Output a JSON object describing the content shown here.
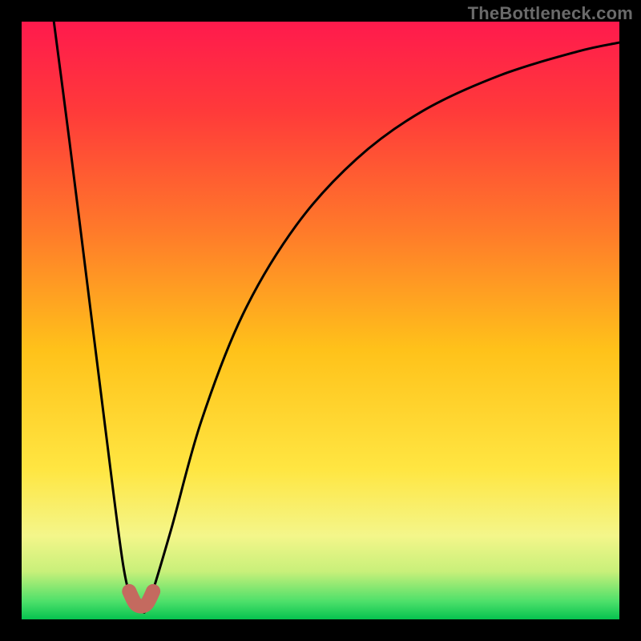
{
  "watermark": "TheBottleneck.com",
  "chart_data": {
    "type": "line",
    "title": "",
    "xlabel": "",
    "ylabel": "",
    "xlim": [
      0,
      1
    ],
    "ylim": [
      0,
      1
    ],
    "gradient_stops": [
      {
        "offset": 0.0,
        "color": "#ff1a4d"
      },
      {
        "offset": 0.15,
        "color": "#ff3a3a"
      },
      {
        "offset": 0.35,
        "color": "#ff7a2a"
      },
      {
        "offset": 0.55,
        "color": "#ffc21a"
      },
      {
        "offset": 0.75,
        "color": "#ffe642"
      },
      {
        "offset": 0.86,
        "color": "#f4f68a"
      },
      {
        "offset": 0.92,
        "color": "#c8f07a"
      },
      {
        "offset": 0.97,
        "color": "#4de06a"
      },
      {
        "offset": 1.0,
        "color": "#06c24f"
      }
    ],
    "series": [
      {
        "name": "bottleneck-curve",
        "color": "#000000",
        "width": 3,
        "x": [
          0.05,
          0.08,
          0.11,
          0.14,
          0.17,
          0.188,
          0.2,
          0.212,
          0.25,
          0.3,
          0.37,
          0.46,
          0.56,
          0.67,
          0.8,
          0.93,
          1.0
        ],
        "values": [
          1.03,
          0.8,
          0.56,
          0.32,
          0.09,
          0.025,
          0.015,
          0.025,
          0.15,
          0.33,
          0.51,
          0.66,
          0.77,
          0.85,
          0.91,
          0.95,
          0.965
        ]
      },
      {
        "name": "trough-marker",
        "color": "#c46a5f",
        "width": 18,
        "linecap": "round",
        "x": [
          0.18,
          0.19,
          0.2,
          0.21,
          0.22
        ],
        "values": [
          0.047,
          0.027,
          0.022,
          0.027,
          0.047
        ]
      }
    ]
  }
}
